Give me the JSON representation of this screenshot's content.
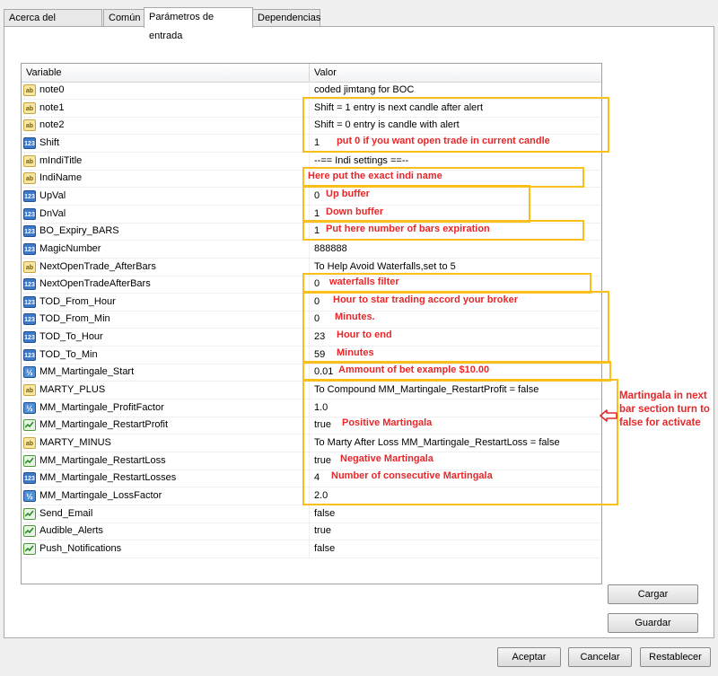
{
  "tabs": [
    "Acerca del programa",
    "Común",
    "Parámetros de entrada",
    "Dependencias"
  ],
  "grid": {
    "headers": [
      "Variable",
      "Valor"
    ],
    "rows": [
      {
        "type": "ab",
        "name": "note0",
        "value": "coded jimtang for BOC"
      },
      {
        "type": "ab",
        "name": "note1",
        "value": "Shift = 1 entry is next candle after alert"
      },
      {
        "type": "ab",
        "name": "note2",
        "value": "Shift = 0 entry is candle with alert"
      },
      {
        "type": "123",
        "name": "Shift",
        "value": "1"
      },
      {
        "type": "ab",
        "name": "mIndiTitle",
        "value": "  --== Indi settings ==--"
      },
      {
        "type": "ab",
        "name": "IndiName",
        "value": ""
      },
      {
        "type": "123",
        "name": "UpVal",
        "value": "0"
      },
      {
        "type": "123",
        "name": "DnVal",
        "value": "1"
      },
      {
        "type": "123",
        "name": "BO_Expiry_BARS",
        "value": "1"
      },
      {
        "type": "123",
        "name": "MagicNumber",
        "value": "888888"
      },
      {
        "type": "ab",
        "name": "NextOpenTrade_AfterBars",
        "value": "To Help Avoid Waterfalls,set to 5"
      },
      {
        "type": "123",
        "name": "NextOpenTradeAfterBars",
        "value": "0"
      },
      {
        "type": "123",
        "name": "TOD_From_Hour",
        "value": "0"
      },
      {
        "type": "123",
        "name": "TOD_From_Min",
        "value": "0"
      },
      {
        "type": "123",
        "name": "TOD_To_Hour",
        "value": "23"
      },
      {
        "type": "123",
        "name": "TOD_To_Min",
        "value": "59"
      },
      {
        "type": "v2",
        "name": "MM_Martingale_Start",
        "value": "0.01"
      },
      {
        "type": "ab",
        "name": "MARTY_PLUS",
        "value": "To Compound MM_Martingale_RestartProfit = false"
      },
      {
        "type": "v2",
        "name": "MM_Martingale_ProfitFactor",
        "value": "1.0"
      },
      {
        "type": "bool",
        "name": "MM_Martingale_RestartProfit",
        "value": "true"
      },
      {
        "type": "ab",
        "name": "MARTY_MINUS",
        "value": "To Marty After Loss MM_Martingale_RestartLoss = false"
      },
      {
        "type": "bool",
        "name": "MM_Martingale_RestartLoss",
        "value": "true"
      },
      {
        "type": "123",
        "name": "MM_Martingale_RestartLosses",
        "value": "4"
      },
      {
        "type": "v2",
        "name": "MM_Martingale_LossFactor",
        "value": "2.0"
      },
      {
        "type": "bool",
        "name": "Send_Email",
        "value": "false"
      },
      {
        "type": "bool",
        "name": "Audible_Alerts",
        "value": "true"
      },
      {
        "type": "bool",
        "name": "Push_Notifications",
        "value": "false"
      }
    ]
  },
  "annotations": [
    {
      "row": 3,
      "text": "put 0 if you want open trade in current candle"
    },
    {
      "row": 5,
      "text": "Here put the exact indi name"
    },
    {
      "row": 6,
      "text": "Up buffer"
    },
    {
      "row": 7,
      "text": "Down buffer"
    },
    {
      "row": 8,
      "text": "Put here number of bars expiration"
    },
    {
      "row": 11,
      "text": "waterfalls filter"
    },
    {
      "row": 12,
      "text": "Hour to star trading accord your broker"
    },
    {
      "row": 13,
      "text": "Minutes."
    },
    {
      "row": 14,
      "text": "Hour to end"
    },
    {
      "row": 15,
      "text": "Minutes"
    },
    {
      "row": 16,
      "text": "Ammount of bet example $10.00"
    },
    {
      "row": 19,
      "text": "Positive Martingala"
    },
    {
      "row": 21,
      "text": "Negative Martingala"
    },
    {
      "row": 22,
      "text": "Number of consecutive Martingala"
    }
  ],
  "sidenote": "Martingala in next bar section turn to false for activate",
  "buttons": {
    "load": "Cargar",
    "save": "Guardar",
    "accept": "Aceptar",
    "cancel": "Cancelar",
    "reset": "Restablecer"
  },
  "colors": {
    "annotation_text": "#e8272a",
    "annotation_box": "#fbbf1c"
  }
}
